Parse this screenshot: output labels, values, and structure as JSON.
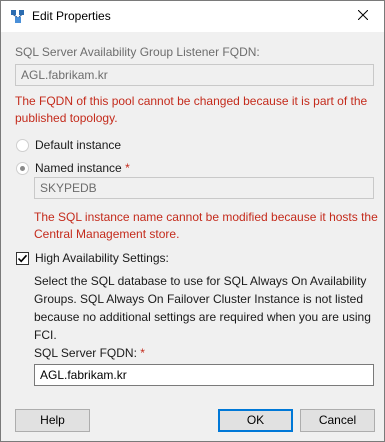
{
  "window": {
    "title": "Edit Properties",
    "close_glyph": "✕",
    "icon": "app-icon"
  },
  "fqdn_section": {
    "label": "SQL Server Availability Group Listener FQDN:",
    "value": "AGL.fabrikam.kr",
    "error_line1": "The FQDN of this pool cannot be changed because it is part of the",
    "error_line2": "published topology."
  },
  "instance": {
    "default_label": "Default instance",
    "default_selected": false,
    "named_label": "Named instance",
    "named_selected": true,
    "required_mark": "*",
    "named_value": "SKYPEDB",
    "error_line1": "The SQL instance name cannot be modified because it hosts the",
    "error_line2": "Central Management store."
  },
  "high_availability": {
    "label": "High Availability Settings:",
    "checked": true,
    "description_lines": [
      "Select the SQL database to use for SQL Always On Availability",
      "Groups. SQL Always On Failover Cluster Instance is not listed",
      "because no additional settings are required when you are using",
      "FCI."
    ],
    "fqdn_label": "SQL Server FQDN:",
    "required_mark": "*",
    "fqdn_value": "AGL.fabrikam.kr"
  },
  "buttons": {
    "help": "Help",
    "ok": "OK",
    "cancel": "Cancel"
  },
  "colors": {
    "error": "#c42b1c",
    "default_button_border": "#0078d7"
  }
}
